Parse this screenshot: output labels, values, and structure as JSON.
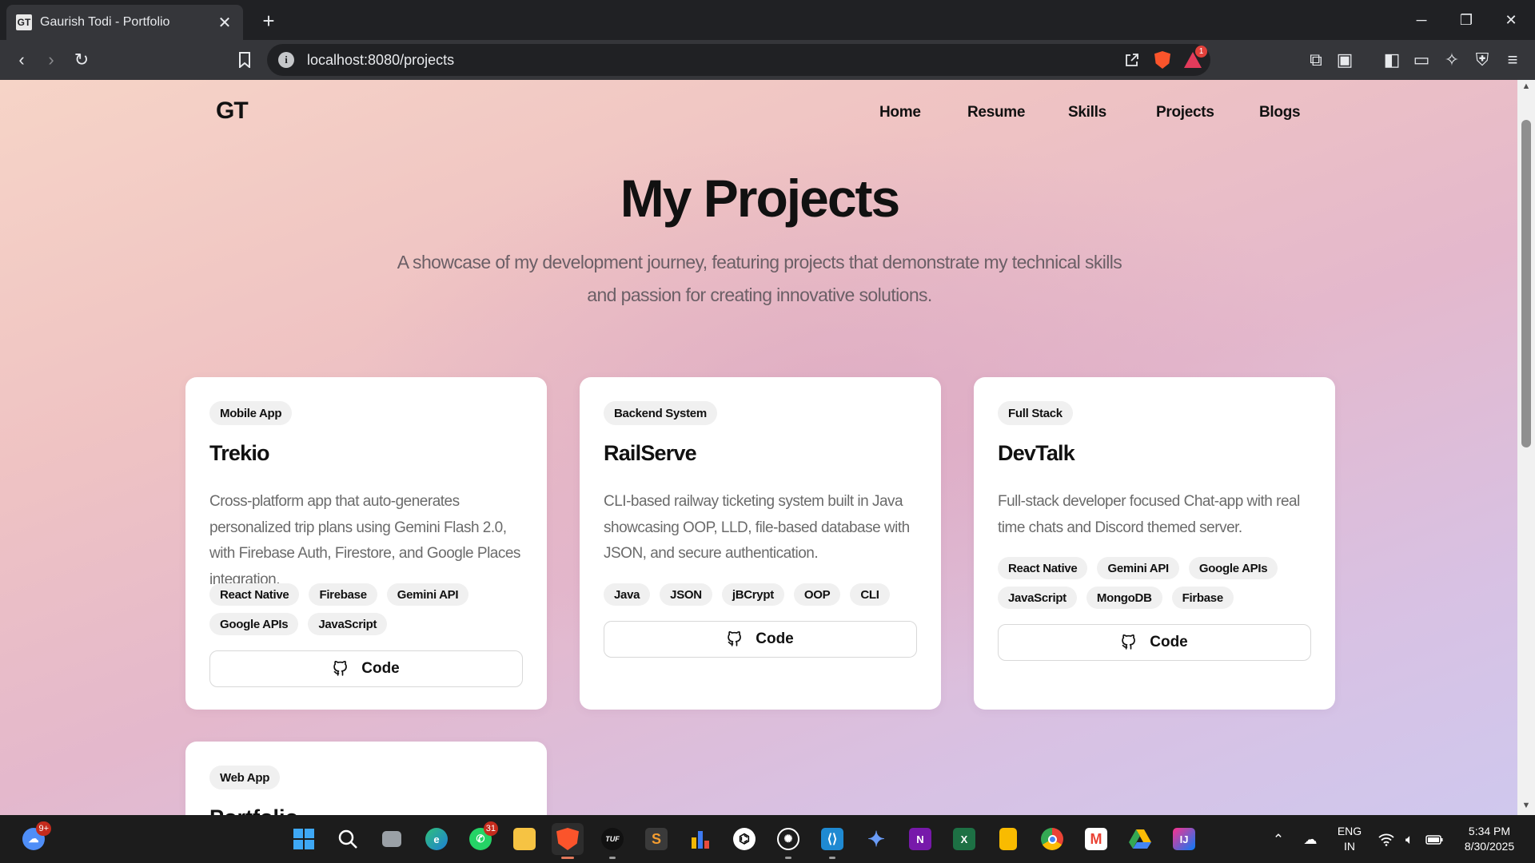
{
  "browser": {
    "tab_title": "Gaurish Todi - Portfolio",
    "favicon_text": "GT",
    "tab_close": "✕",
    "new_tab": "+",
    "url": "localhost:8080/projects",
    "rewards_badge": "1",
    "window_controls": {
      "minimize": "─",
      "restore": "❐",
      "close": "✕"
    }
  },
  "site": {
    "logo": "GT",
    "nav": [
      "Home",
      "Resume",
      "Skills",
      "Projects",
      "Blogs"
    ]
  },
  "hero": {
    "title": "My Projects",
    "subtitle": "A showcase of my development journey, featuring projects that demonstrate my technical skills and passion for creating innovative solutions."
  },
  "projects": [
    {
      "category": "Mobile App",
      "title": "Trekio",
      "description": "Cross-platform app that auto-generates personalized trip plans using Gemini Flash 2.0, with Firebase Auth, Firestore, and Google Places integration.",
      "tags": [
        "React Native",
        "Firebase",
        "Gemini API",
        "Google APIs",
        "JavaScript"
      ],
      "button": "Code"
    },
    {
      "category": "Backend System",
      "title": "RailServe",
      "description": "CLI-based railway ticketing system built in Java showcasing OOP, LLD, file-based database with JSON, and secure authentication.",
      "tags": [
        "Java",
        "JSON",
        "jBCrypt",
        "OOP",
        "CLI"
      ],
      "button": "Code"
    },
    {
      "category": "Full Stack",
      "title": "DevTalk",
      "description": "Full-stack developer focused Chat-app with real time chats and Discord themed server.",
      "tags": [
        "React Native",
        "Gemini API",
        "Google APIs",
        "JavaScript",
        "MongoDB",
        "Firbase"
      ],
      "button": "Code"
    },
    {
      "category": "Web App",
      "title": "Portfolio"
    }
  ],
  "taskbar": {
    "weather_badge": "9+",
    "whatsapp_badge": "31",
    "tuf_label": "TUF",
    "language": "ENG",
    "region": "IN",
    "time": "5:34 PM",
    "date": "8/30/2025"
  },
  "colors": {
    "brave": "#fb542b",
    "page_gradient_start": "#f6d4c7",
    "page_gradient_end": "#cfc8ee"
  }
}
